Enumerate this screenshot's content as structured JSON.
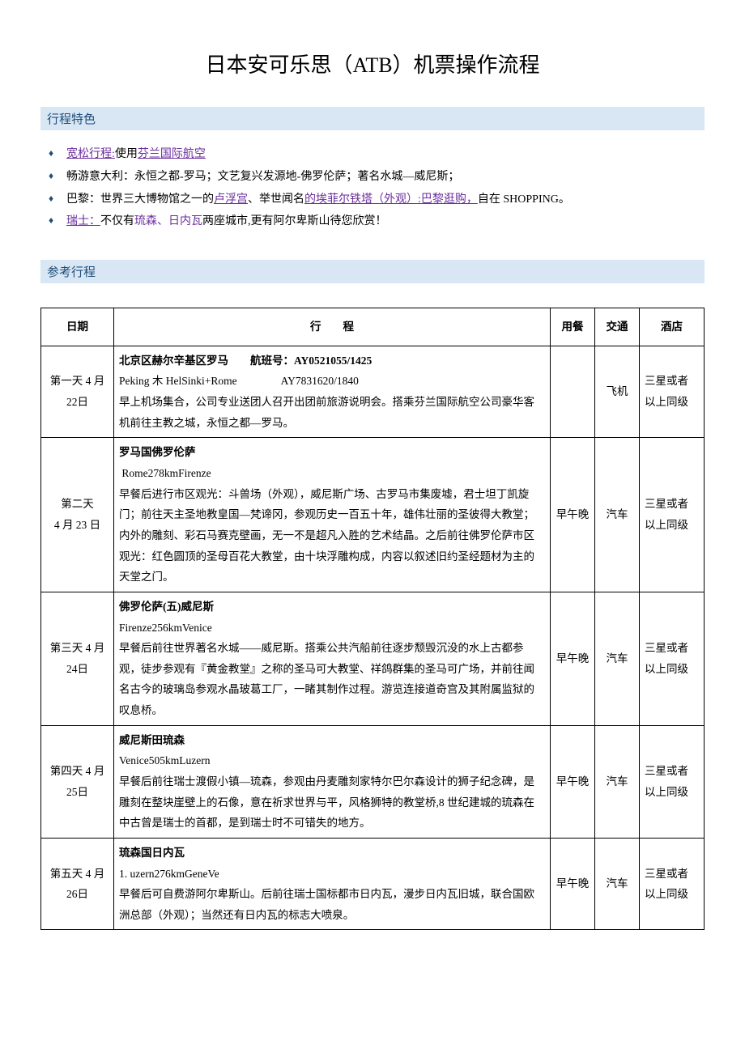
{
  "title": "日本安可乐思（ATB）机票操作流程",
  "section1": "行程特色",
  "features": {
    "f1a": "宽松行程:",
    "f1b": "使用",
    "f1c": "芬兰国际航空",
    "f2": "畅游意大利：永恒之都-罗马；文艺复兴发源地-佛罗伦萨；著名水城—威尼斯；",
    "f3a": "巴黎：世界三大博物馆之一的",
    "f3b": "卢浮宫",
    "f3c": "、举世闻名",
    "f3d": "的埃菲尔铁塔（外观）",
    "f3e": ":巴黎逛购，",
    "f3f": "自在 SHOPPING。",
    "f4a": "瑞士：",
    "f4b": "不仅有",
    "f4c": "琉森、日内瓦",
    "f4d": "两座城市,更有阿尔卑斯山待您欣赏！"
  },
  "section2": "参考行程",
  "headers": {
    "date": "日期",
    "itin": "行　　程",
    "meal": "用餐",
    "trans": "交通",
    "hotel": "酒店"
  },
  "rows": [
    {
      "date": "第一天 4 月 22日",
      "title": "北京区赫尔辛基区罗马　　航班号：AY0521055/1425",
      "line2": "Peking 木 HelSinki+Rome　　　　AY7831620/1840",
      "body": "早上机场集合，公司专业送团人召开出团前旅游说明会。搭乘芬兰国际航空公司豪华客机前往主教之城，永恒之都—罗马。",
      "meal": "",
      "trans": "飞机",
      "hotel": "三星或者以上同级"
    },
    {
      "date": "第二天\n4 月 23 日",
      "title": "罗马国佛罗伦萨",
      "line2": " Rome278kmFirenze",
      "body": "早餐后进行市区观光：斗兽场（外观），威尼斯广场、古罗马市集废墟，君士坦丁凯旋门；前往天主圣地教皇国—梵谛冈，参观历史一百五十年，雄伟壮丽的圣彼得大教堂；内外的雕刻、彩石马赛克壁画，无一不是超凡入胜的艺术结晶。之后前往佛罗伦萨市区观光：红色圆顶的圣母百花大教堂，由十块浮雕构成，内容以叙述旧约圣经题材为主的天堂之门。",
      "meal": "早午晚",
      "trans": "汽车",
      "hotel": "三星或者以上同级"
    },
    {
      "date": "第三天 4 月 24日",
      "title": "佛罗伦萨(五)威尼斯",
      "line2": "Firenze256kmVenice",
      "body": "早餐后前往世界著名水城——威尼斯。搭乘公共汽船前往逐步颓毁沉没的水上古都参观，徒步参观有『黄金教堂』之称的圣马可大教堂、祥鸽群集的圣马可广场，并前往闻名古今的玻璃岛参观水晶玻葛工厂，一睹其制作过程。游览连接道奇宫及其附属监狱的叹息桥。",
      "meal": "早午晚",
      "trans": "汽车",
      "hotel": "三星或者以上同级"
    },
    {
      "date": "第四天 4 月 25日",
      "title": "威尼斯田琉森",
      "line2": "Venice505kmLuzern",
      "body": "早餐后前往瑞士渡假小镇—琉森，参观由丹麦雕刻家特尔巴尔森设计的狮子纪念碑，是雕刻在整块崖壁上的石像，意在祈求世界与平，风格狮特的教堂桥,8 世纪建城的琉森在中古曾是瑞士的首都，是到瑞士时不可错失的地方。",
      "meal": "早午晚",
      "trans": "汽车",
      "hotel": "三星或者以上同级"
    },
    {
      "date": "第五天 4 月 26日",
      "title": "琉森国日内瓦",
      "line2": "1. uzern276kmGeneVe",
      "body": "早餐后可自费游阿尔卑斯山。后前往瑞士国标都市日内瓦，漫步日内瓦旧城，联合国欧洲总部（外观）；当然还有日内瓦的标志大喷泉。",
      "meal": "早午晚",
      "trans": "汽车",
      "hotel": "三星或者以上同级"
    }
  ]
}
